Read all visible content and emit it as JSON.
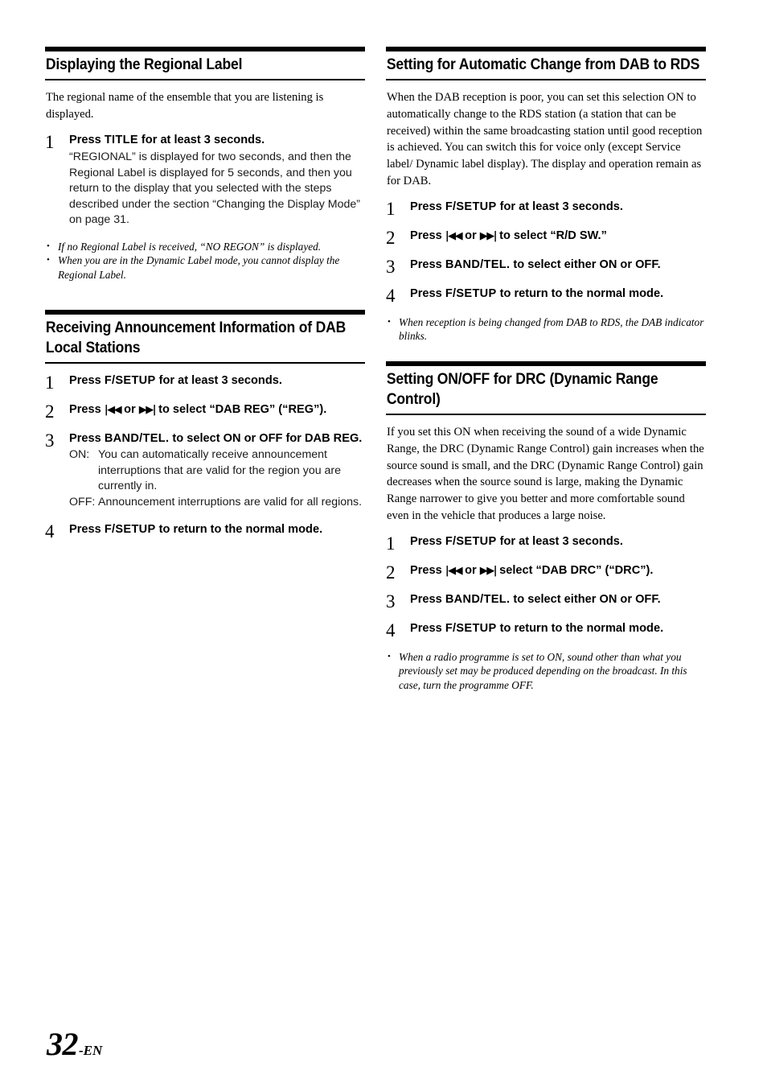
{
  "document": {
    "page_label": "32",
    "page_suffix": "-EN"
  },
  "left_column": {
    "section1": {
      "heading": "Displaying the Regional Label",
      "intro": "The regional name of the ensemble that you are listening is displayed.",
      "steps": [
        {
          "number": "1",
          "title_prefix": "Press ",
          "key": "TITLE",
          "title_suffix": " for at least 3 seconds.",
          "description": "“REGIONAL” is displayed for two seconds, and then the Regional Label is displayed for 5 seconds, and then you return to the display that you selected with the steps described under the section “Changing the Display Mode” on page 31."
        }
      ],
      "notes": [
        "If no Regional Label is received, “NO REGON”  is displayed.",
        "When you are in the Dynamic Label mode, you cannot display the Regional Label."
      ]
    },
    "section2": {
      "heading": "Receiving Announcement Information of DAB Local Stations",
      "steps": [
        {
          "number": "1",
          "title_prefix": "Press ",
          "key": "F/SETUP",
          "title_suffix": " for at least 3 seconds."
        },
        {
          "number": "2",
          "title_prefix": "Press ",
          "arrow_prev": "|◀◀",
          "arrow_mid": " or ",
          "arrow_next": "▶▶|",
          "title_suffix": " to select “DAB REG” (“REG”)."
        },
        {
          "number": "3",
          "title_prefix": "Press ",
          "key": "BAND/TEL.",
          "title_suffix": " to select ON or OFF for DAB REG.",
          "options": [
            {
              "key": "ON:",
              "value": "You can automatically receive announcement interruptions that are valid for the region you are currently in."
            },
            {
              "key": "OFF:",
              "value": "Announcement interruptions are valid for all regions."
            }
          ]
        },
        {
          "number": "4",
          "title_prefix": "Press ",
          "key": "F/SETUP",
          "title_suffix": " to return to the normal mode."
        }
      ]
    }
  },
  "right_column": {
    "section1": {
      "heading": "Setting for Automatic Change from DAB to RDS",
      "intro": "When the DAB reception is poor, you can set this selection ON to automatically change to the RDS station (a station that can be received) within the same broadcasting station until good reception is achieved.  You can switch this for voice only (except Service label/ Dynamic label display). The display and operation remain as for DAB.",
      "steps": [
        {
          "number": "1",
          "title_prefix": "Press ",
          "key": "F/SETUP",
          "title_suffix": " for at least 3 seconds."
        },
        {
          "number": "2",
          "title_prefix": "Press ",
          "arrow_prev": "|◀◀",
          "arrow_mid": " or ",
          "arrow_next": "▶▶|",
          "title_suffix": " to select “R/D SW.”"
        },
        {
          "number": "3",
          "title_prefix": "Press ",
          "key": "BAND/TEL.",
          "title_suffix": " to select either ON or OFF."
        },
        {
          "number": "4",
          "title_prefix": "Press ",
          "key": "F/SETUP",
          "title_suffix": " to return to the normal mode."
        }
      ],
      "notes": [
        "When reception is being changed from DAB to RDS, the DAB indicator blinks."
      ]
    },
    "section2": {
      "heading": "Setting ON/OFF for DRC (Dynamic Range Control)",
      "intro": "If you set this ON when receiving the sound of a wide Dynamic Range, the DRC (Dynamic Range Control) gain increases when the source sound is small, and the DRC (Dynamic Range Control) gain decreases when the source sound is large, making the Dynamic Range narrower to give you better and more comfortable sound even in the vehicle that produces a large noise.",
      "steps": [
        {
          "number": "1",
          "title_prefix": "Press ",
          "key": "F/SETUP",
          "title_suffix": " for at least 3 seconds."
        },
        {
          "number": "2",
          "title_prefix": "Press ",
          "arrow_prev": "|◀◀",
          "arrow_mid": " or ",
          "arrow_next": "▶▶|",
          "title_suffix": " select “DAB DRC” (“DRC”)."
        },
        {
          "number": "3",
          "title_prefix": "Press ",
          "key": "BAND/TEL.",
          "title_suffix": " to select either ON or OFF."
        },
        {
          "number": "4",
          "title_prefix": "Press ",
          "key": "F/SETUP",
          "title_suffix": " to return to the normal mode."
        }
      ],
      "notes": [
        "When a radio programme is set to ON, sound other than what you previously set may be produced depending on the broadcast. In this case, turn the programme OFF."
      ]
    }
  },
  "bullet_glyph": "•"
}
